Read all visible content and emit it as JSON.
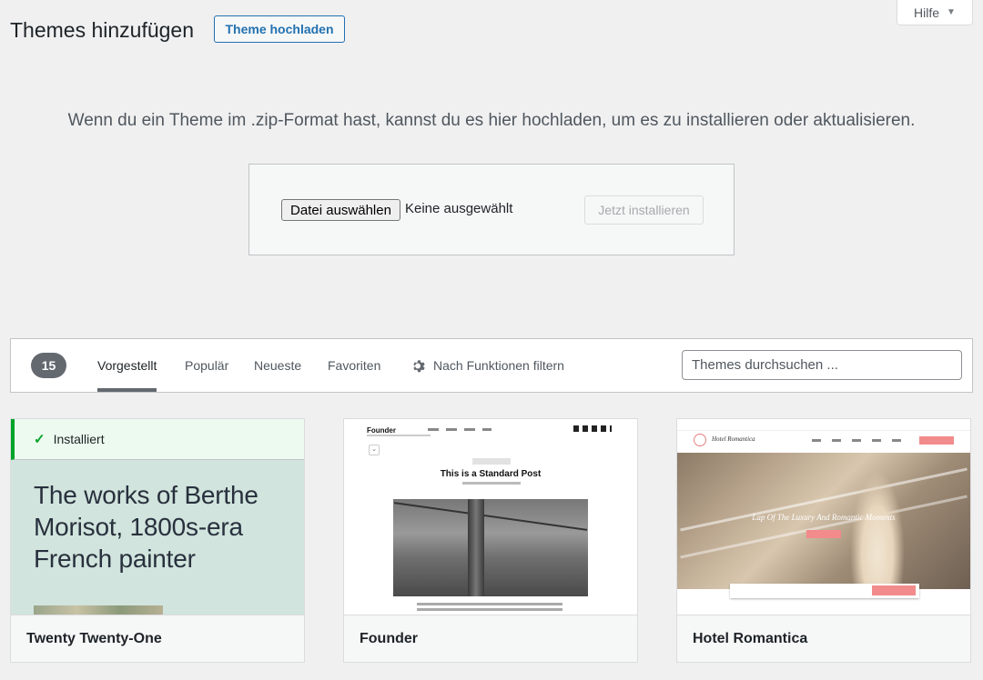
{
  "header": {
    "title": "Themes hinzufügen",
    "upload_button": "Theme hochladen",
    "help_tab": "Hilfe"
  },
  "upload": {
    "description": "Wenn du ein Theme im .zip-Format hast, kannst du es hier hochladen, um es zu installieren oder aktualisieren.",
    "file_button": "Datei auswählen",
    "file_status": "Keine ausgewählt",
    "install_button": "Jetzt installieren"
  },
  "filter_bar": {
    "count": "15",
    "tabs": [
      {
        "label": "Vorgestellt",
        "active": true
      },
      {
        "label": "Populär",
        "active": false
      },
      {
        "label": "Neueste",
        "active": false
      },
      {
        "label": "Favoriten",
        "active": false
      }
    ],
    "feature_filter": "Nach Funktionen filtern",
    "search_placeholder": "Themes durchsuchen ..."
  },
  "themes": [
    {
      "name": "Twenty Twenty-One",
      "installed": true,
      "installed_label": "Installiert",
      "preview_text": "The works of Berthe Morisot, 1800s-era French painter"
    },
    {
      "name": "Founder",
      "installed": false,
      "preview_brand": "Founder",
      "preview_title": "This is a Standard Post"
    },
    {
      "name": "Hotel Romantica",
      "installed": false,
      "preview_brand": "Hotel Romantica",
      "preview_headline": "Lap Of The Luxury And Romantic Moments"
    }
  ],
  "colors": {
    "accent": "#2271b1",
    "installed_green": "#00a32a",
    "count_badge": "#646970",
    "tt1_background": "#d1e4dd"
  }
}
